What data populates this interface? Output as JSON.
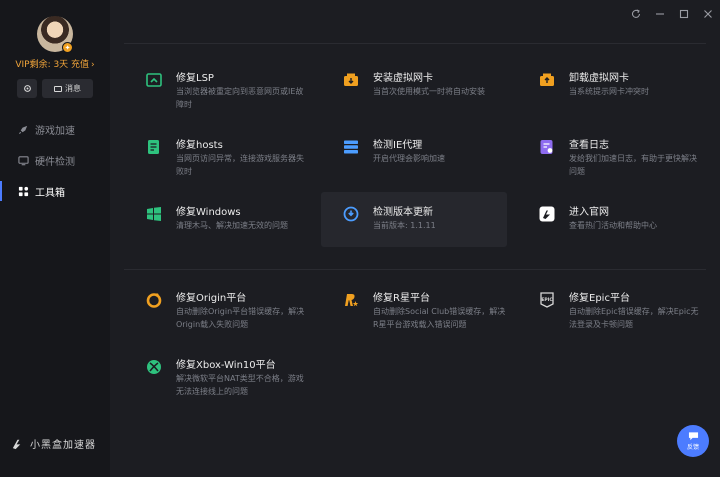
{
  "sidebar": {
    "vip_text": "VIP剩余: 3天 充值",
    "vip_arrow": "›",
    "settings_icon": "gear-icon",
    "message_label": "消息",
    "nav": [
      {
        "label": "游戏加速",
        "icon": "rocket-icon"
      },
      {
        "label": "硬件检测",
        "icon": "monitor-icon"
      },
      {
        "label": "工具箱",
        "icon": "grid-icon"
      }
    ],
    "brand": "小黑盒加速器"
  },
  "feedback_label": "反馈",
  "tools": [
    {
      "title": "修复LSP",
      "desc": "当浏览器被重定向到恶意网页或IE故障时",
      "color": "#2ec27e",
      "icon": "browser-repair-icon"
    },
    {
      "title": "安装虚拟网卡",
      "desc": "当首次使用模式一时将自动安装",
      "color": "#f0a020",
      "icon": "install-nic-icon"
    },
    {
      "title": "卸载虚拟网卡",
      "desc": "当系统提示网卡冲突时",
      "color": "#f0a020",
      "icon": "uninstall-nic-icon"
    },
    {
      "title": "修复hosts",
      "desc": "当网页访问异常，连接游戏服务器失败时",
      "color": "#2ec27e",
      "icon": "hosts-icon"
    },
    {
      "title": "检测IE代理",
      "desc": "开启代理会影响加速",
      "color": "#4c9dff",
      "icon": "proxy-icon"
    },
    {
      "title": "查看日志",
      "desc": "发给我们加速日志，有助于更快解决问题",
      "color": "#8e6cf0",
      "icon": "log-icon"
    },
    {
      "title": "修复Windows",
      "desc": "清理木马、解决加速无效的问题",
      "color": "#2ec27e",
      "icon": "windows-icon"
    },
    {
      "title": "检测版本更新",
      "desc": "当前版本: 1.1.11",
      "color": "#4c9dff",
      "icon": "update-icon"
    },
    {
      "title": "进入官网",
      "desc": "查看热门活动和帮助中心",
      "color": "#ffffff",
      "icon": "website-icon"
    }
  ],
  "platforms": [
    {
      "title": "修复Origin平台",
      "desc": "自动删除Origin平台错误缓存，解决Origin载入失败问题",
      "color": "#f0a020",
      "icon": "origin-icon"
    },
    {
      "title": "修复R星平台",
      "desc": "自动删除Social Club错误缓存，解决R星平台游戏载入错误问题",
      "color": "#f0a020",
      "icon": "rockstar-icon"
    },
    {
      "title": "修复Epic平台",
      "desc": "自动删除Epic错误缓存，解决Epic无法登录及卡顿问题",
      "color": "#d8d8d8",
      "icon": "epic-icon"
    },
    {
      "title": "修复Xbox-Win10平台",
      "desc": "解决微软平台NAT类型不合格，游戏无法连接线上的问题",
      "color": "#2ec27e",
      "icon": "xbox-icon"
    }
  ]
}
